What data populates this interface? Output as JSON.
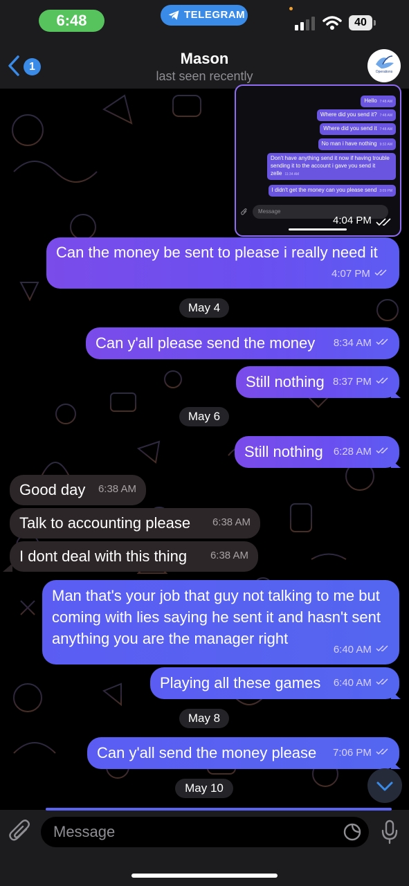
{
  "status_bar": {
    "time": "6:48",
    "app_pill": "TELEGRAM",
    "battery": "40"
  },
  "header": {
    "back_count": "1",
    "name": "Mason",
    "status": "last seen recently",
    "avatar_label": "Operations"
  },
  "screenshot_preview": {
    "messages": [
      {
        "text": "Hello",
        "time": "7:48 AM"
      },
      {
        "text": "Where did you send it?",
        "time": "7:48 AM"
      },
      {
        "text": "Where did you send it",
        "time": "7:48 AM"
      },
      {
        "text": "No man i have nothing",
        "time": "9:32 AM"
      },
      {
        "text": "Don't have anything send it now if having trouble sending it to the account i gave you send it zelle",
        "time": "11:34 AM"
      },
      {
        "text": "I didn't get the money can you please send",
        "time": "3:09 PM"
      }
    ],
    "input_placeholder": "Message",
    "time": "4:04 PM"
  },
  "messages": [
    {
      "text": "Can the money be sent to please i really need it",
      "time": "4:07 PM"
    },
    {
      "date": "May 4"
    },
    {
      "text": "Can y'all please send the money",
      "time": "8:34 AM"
    },
    {
      "text": "Still nothing",
      "time": "8:37 PM"
    },
    {
      "date": "May 6"
    },
    {
      "text": "Still nothing",
      "time": "6:28 AM"
    },
    {
      "text": "Good day",
      "time": "6:38 AM"
    },
    {
      "text": "Talk to accounting please",
      "time": "6:38 AM"
    },
    {
      "text": "I dont deal with this thing",
      "time": "6:38 AM"
    },
    {
      "text": "Man that's your job that guy not talking to me but coming with lies saying he sent it and hasn't sent anything you are the manager right",
      "time": "6:40 AM"
    },
    {
      "text": "Playing all these games",
      "time": "6:40 AM"
    },
    {
      "date": "May 8"
    },
    {
      "text": "Can y'all send the money please",
      "time": "7:06 PM"
    },
    {
      "date": "May 10"
    }
  ],
  "composer": {
    "placeholder": "Message"
  },
  "colors": {
    "outgoing_purple": "#7a4cea",
    "outgoing_blue": "#5b5df2",
    "incoming": "#2c2628",
    "accent": "#3a8be8",
    "time_pill": "#56c35d"
  }
}
